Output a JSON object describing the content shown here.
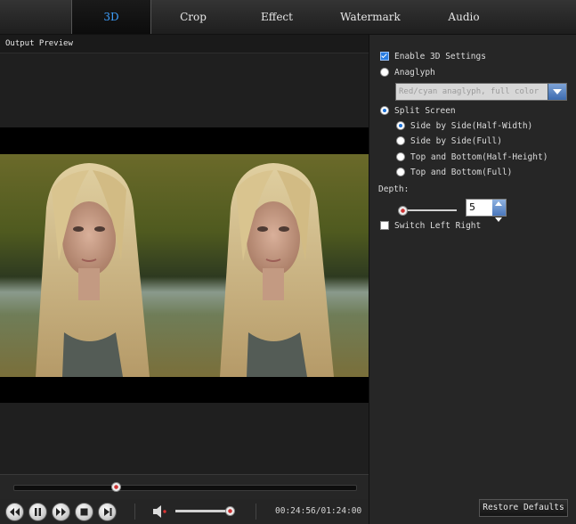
{
  "tabs": [
    {
      "label": "3D",
      "active": true
    },
    {
      "label": "Crop",
      "active": false
    },
    {
      "label": "Effect",
      "active": false
    },
    {
      "label": "Watermark",
      "active": false
    },
    {
      "label": "Audio",
      "active": false
    }
  ],
  "preview": {
    "title": "Output Preview"
  },
  "settings": {
    "enable_3d": {
      "label": "Enable 3D Settings",
      "checked": true
    },
    "anaglyph": {
      "label": "Anaglyph",
      "selected": false
    },
    "anaglyph_select": {
      "value": "Red/cyan anaglyph, full color"
    },
    "split_screen": {
      "label": "Split Screen",
      "selected": true
    },
    "split_options": [
      {
        "label": "Side by Side(Half-Width)",
        "selected": true
      },
      {
        "label": "Side by Side(Full)",
        "selected": false
      },
      {
        "label": "Top and Bottom(Half-Height)",
        "selected": false
      },
      {
        "label": "Top and Bottom(Full)",
        "selected": false
      }
    ],
    "depth_label": "Depth:",
    "depth_value": "5",
    "switch_left_right": {
      "label": "Switch Left Right",
      "checked": false
    },
    "restore_label": "Restore Defaults"
  },
  "player": {
    "time": "00:24:56/01:24:00",
    "progress": 0.3,
    "volume": 0.93
  },
  "colors": {
    "accent": "#3ea0ff",
    "panel_bg": "#262626",
    "video_bg": "#000000"
  }
}
